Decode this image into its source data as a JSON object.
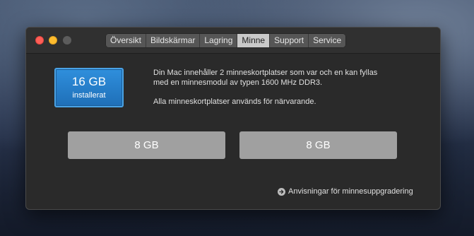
{
  "window": {
    "tabs": [
      {
        "label": "Översikt"
      },
      {
        "label": "Bildskärmar"
      },
      {
        "label": "Lagring"
      },
      {
        "label": "Minne",
        "active": true
      },
      {
        "label": "Support"
      },
      {
        "label": "Service"
      }
    ]
  },
  "memory": {
    "installed_size": "16 GB",
    "installed_label": "installerat",
    "description": "Din Mac innehåller 2 minneskortplatser som var och en kan fyllas med en minnesmodul av typen 1600 MHz DDR3.",
    "slots_note": "Alla minneskortplatser används för närvarande.",
    "slots": [
      {
        "size": "8 GB"
      },
      {
        "size": "8 GB"
      }
    ],
    "upgrade_link": "Anvisningar för minnesuppgradering"
  },
  "icons": {
    "close": "close-icon",
    "minimize": "minimize-icon",
    "zoom": "zoom-icon",
    "upgrade": "arrow-circle-right-icon"
  },
  "colors": {
    "badge_accent": "#2f8fdc",
    "slot_fill": "#a0a0a0",
    "close": "#ff5f57",
    "minimize": "#febc2e"
  }
}
